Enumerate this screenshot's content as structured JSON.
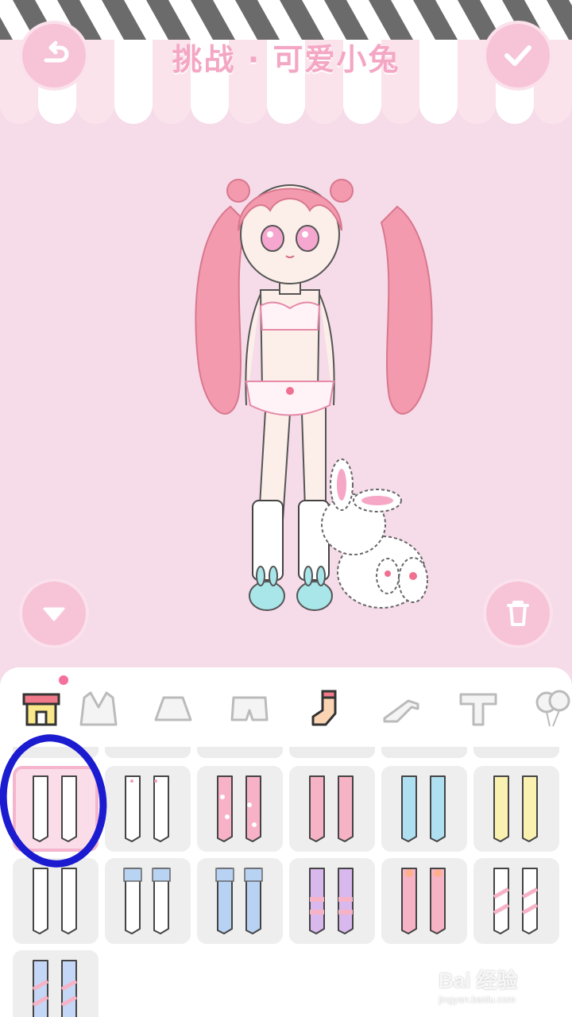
{
  "header": {
    "title": "挑战 · 可爱小兔",
    "back_icon": "back-arrow-icon",
    "confirm_icon": "checkmark-icon"
  },
  "stage": {
    "down_icon": "triangle-down-icon",
    "trash_icon": "trash-icon"
  },
  "tabs": [
    {
      "name": "shop",
      "icon": "shop-icon",
      "new_dot": true
    },
    {
      "name": "jacket",
      "icon": "jacket-icon"
    },
    {
      "name": "skirt",
      "icon": "skirt-icon"
    },
    {
      "name": "shorts",
      "icon": "shorts-icon"
    },
    {
      "name": "socks",
      "icon": "sock-icon",
      "active": true
    },
    {
      "name": "shoes",
      "icon": "high-heel-icon"
    },
    {
      "name": "top",
      "icon": "tshirt-icon"
    },
    {
      "name": "accessory",
      "icon": "balloon-icon"
    }
  ],
  "items": [
    {
      "style": "plain",
      "colors": [
        "#ffffff",
        "#ffffff"
      ],
      "selected": true
    },
    {
      "style": "hearts",
      "colors": [
        "#ffffff",
        "#f29ab8"
      ]
    },
    {
      "style": "dots",
      "colors": [
        "#f7b2c8",
        "#ffffff"
      ]
    },
    {
      "style": "plain",
      "colors": [
        "#f6b3c6",
        "#f6b3c6"
      ]
    },
    {
      "style": "plain",
      "colors": [
        "#aee0f2",
        "#aee0f2"
      ]
    },
    {
      "style": "plain",
      "colors": [
        "#faf0b0",
        "#faf0b0"
      ]
    },
    {
      "style": "ruffle",
      "colors": [
        "#ffffff",
        "#ffffff"
      ]
    },
    {
      "style": "ruffle-blue",
      "colors": [
        "#ffffff",
        "#b9d3f2"
      ]
    },
    {
      "style": "slouch",
      "colors": [
        "#b8d2f4",
        "#b8d2f4"
      ]
    },
    {
      "style": "striped",
      "colors": [
        "#d9b8ee",
        "#f6b3c6"
      ]
    },
    {
      "style": "ribbon",
      "colors": [
        "#f6b3c6",
        "#ffb08a"
      ]
    },
    {
      "style": "diagonal",
      "colors": [
        "#ffffff",
        "#f6b3c6"
      ]
    },
    {
      "style": "gradient",
      "colors": [
        "#c5d7f7",
        "#f6b3c6"
      ]
    }
  ],
  "watermark": {
    "main": "Bai 经验",
    "sub": "jingyan.baidu.com"
  },
  "colors": {
    "background": "#f6dbe9",
    "accent": "#f4a7c4",
    "annotation": "#1b1bd0"
  }
}
